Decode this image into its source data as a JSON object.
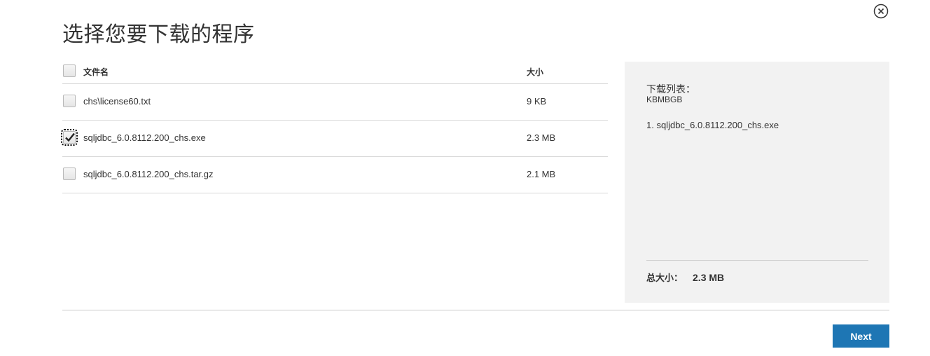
{
  "dialog": {
    "title": "选择您要下载的程序",
    "close_icon": "close-circle-icon"
  },
  "table": {
    "headers": {
      "name": "文件名",
      "size": "大小"
    },
    "header_checked": false,
    "rows": [
      {
        "name": "chs\\license60.txt",
        "size": "9 KB",
        "checked": false
      },
      {
        "name": "sqljdbc_6.0.8112.200_chs.exe",
        "size": "2.3 MB",
        "checked": true
      },
      {
        "name": "sqljdbc_6.0.8112.200_chs.tar.gz",
        "size": "2.1 MB",
        "checked": false
      }
    ]
  },
  "summary": {
    "title": "下载列表：",
    "subtitle": "KBMBGB",
    "items": [
      "1. sqljdbc_6.0.8112.200_chs.exe"
    ],
    "total_label": "总大小：",
    "total_value": "2.3 MB"
  },
  "footer": {
    "next_label": "Next"
  },
  "colors": {
    "accent": "#1e76b4",
    "panel_bg": "#f2f2f2"
  }
}
